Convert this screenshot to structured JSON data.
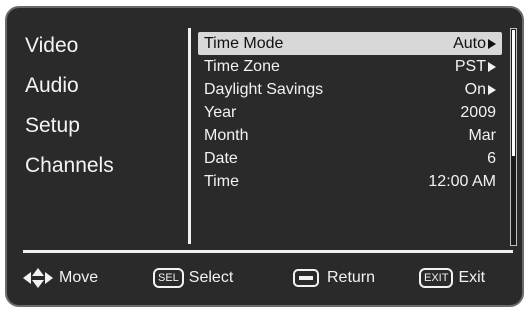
{
  "sidebar": {
    "items": [
      {
        "label": "Video"
      },
      {
        "label": "Audio"
      },
      {
        "label": "Setup"
      },
      {
        "label": "Channels"
      }
    ]
  },
  "menu": {
    "rows": [
      {
        "label": "Time Mode",
        "value": "Auto",
        "has_arrow": true,
        "selected": true
      },
      {
        "label": "Time Zone",
        "value": "PST",
        "has_arrow": true,
        "selected": false
      },
      {
        "label": "Daylight Savings",
        "value": "On",
        "has_arrow": true,
        "selected": false
      },
      {
        "label": "Year",
        "value": "2009",
        "has_arrow": false,
        "selected": false
      },
      {
        "label": "Month",
        "value": "Mar",
        "has_arrow": false,
        "selected": false
      },
      {
        "label": "Date",
        "value": "6",
        "has_arrow": false,
        "selected": false
      },
      {
        "label": "Time",
        "value": "12:00 AM",
        "has_arrow": false,
        "selected": false
      }
    ]
  },
  "footer": {
    "move_label": "Move",
    "select_badge": "SEL",
    "select_label": "Select",
    "return_label": "Return",
    "exit_badge": "EXIT",
    "exit_label": "Exit"
  },
  "colors": {
    "background": "#2a2a2a",
    "text": "#f2f2f2",
    "highlight": "#d8d8d8"
  }
}
